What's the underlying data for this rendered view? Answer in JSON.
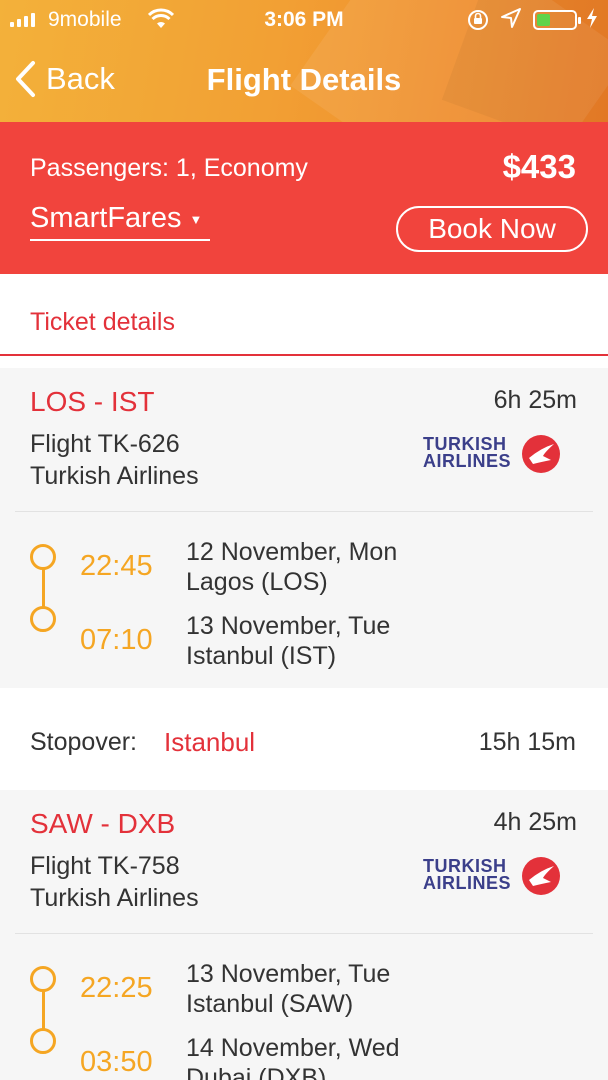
{
  "status_bar": {
    "carrier": "9mobile",
    "time": "3:06 PM"
  },
  "nav": {
    "back_label": "Back",
    "title": "Flight Details"
  },
  "booking": {
    "passengers": "Passengers: 1, Economy",
    "price": "$433",
    "fare_selector": "SmartFares",
    "book_label": "Book Now"
  },
  "tab": {
    "label": "Ticket details"
  },
  "segments": [
    {
      "route": "LOS - IST",
      "duration": "6h 25m",
      "flight": "Flight TK-626",
      "airline": "Turkish Airlines",
      "logo_text_1": "TURKISH",
      "logo_text_2": "AIRLINES",
      "departure": {
        "time": "22:45",
        "date": "12 November, Mon",
        "place": "Lagos (LOS)"
      },
      "arrival": {
        "time": "07:10",
        "date": "13 November, Tue",
        "place": "Istanbul (IST)"
      }
    },
    {
      "route": "SAW - DXB",
      "duration": "4h 25m",
      "flight": "Flight TK-758",
      "airline": "Turkish Airlines",
      "logo_text_1": "TURKISH",
      "logo_text_2": "AIRLINES",
      "departure": {
        "time": "22:25",
        "date": "13 November, Tue",
        "place": "Istanbul (SAW)"
      },
      "arrival": {
        "time": "03:50",
        "date": "14 November, Wed",
        "place": "Dubai (DXB)"
      }
    }
  ],
  "stopover": {
    "label": "Stopover:",
    "city": "Istanbul",
    "duration": "15h 15m"
  },
  "colors": {
    "header_orange": "#f2a034",
    "booking_red": "#f1443d",
    "accent_red": "#e3313a",
    "time_orange": "#f5a623",
    "card_bg": "#f6f6f6",
    "logo_navy": "#3b3f8a"
  },
  "icons": {
    "wifi": "wifi-icon",
    "rotation_lock": "rotation-lock-icon",
    "location": "location-arrow-icon",
    "battery": "battery-icon",
    "charging": "charging-bolt-icon",
    "back": "chevron-left-icon",
    "dropdown": "caret-down-icon",
    "airline_logo": "turkish-airlines-logo"
  }
}
